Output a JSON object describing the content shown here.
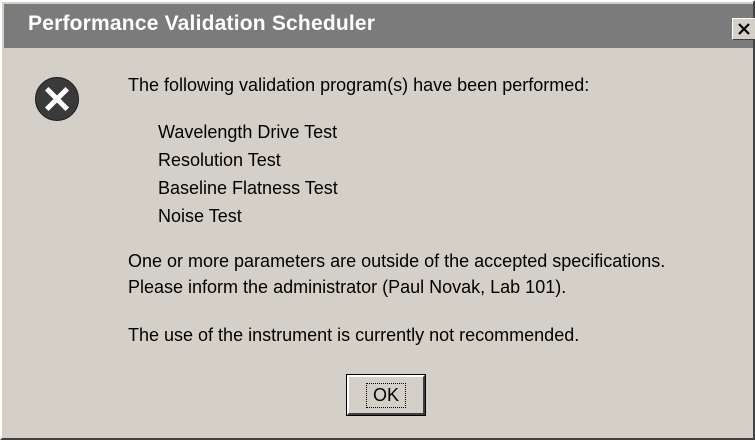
{
  "window": {
    "title": "Performance Validation Scheduler",
    "close_icon": "close-icon"
  },
  "dialog": {
    "icon": "error-icon",
    "intro": "The following validation program(s) have been performed:",
    "tests": [
      "Wavelength Drive Test",
      "Resolution Test",
      "Baseline Flatness Test",
      "Noise Test"
    ],
    "warning_line1": "One or more parameters are outside of the accepted specifications.",
    "warning_line2": "Please inform the administrator (Paul Novak, Lab 101).",
    "recommendation": "The use of the instrument is currently not recommended.",
    "ok_label": "OK"
  },
  "colors": {
    "titlebar": "#7b7b7b",
    "face": "#d4d0c8",
    "icon_fill": "#3a3a3a"
  }
}
